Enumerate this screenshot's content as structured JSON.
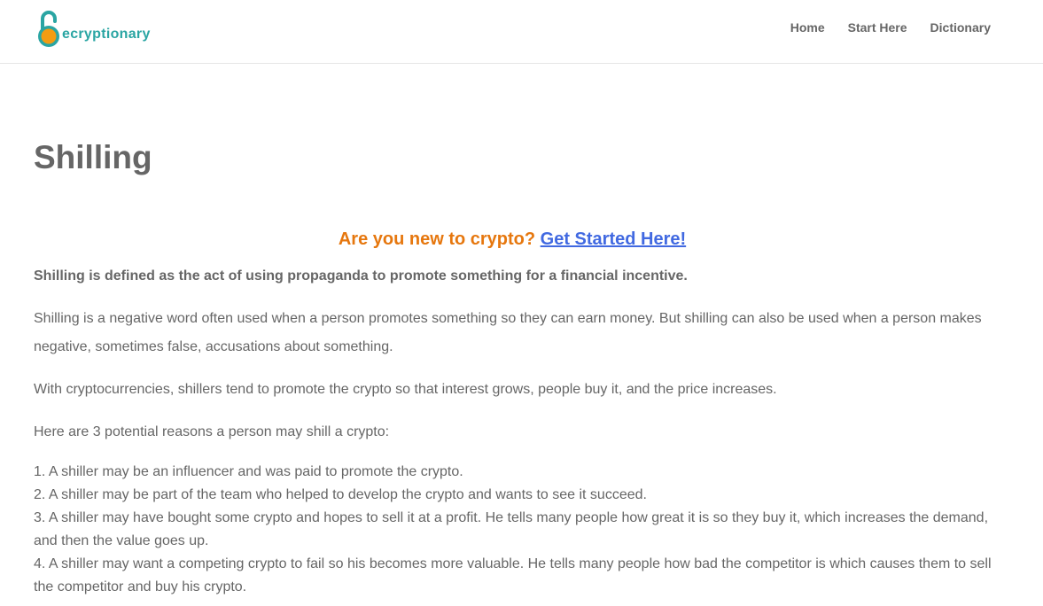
{
  "site": {
    "logo_text": "ecryptionary",
    "colors": {
      "brand_teal": "#2aa5a3",
      "brand_orange": "#f39c12",
      "cta_orange": "#e6770e",
      "link_blue": "#4169e1",
      "text_gray": "#666666"
    }
  },
  "nav": {
    "items": [
      {
        "label": "Home"
      },
      {
        "label": "Start Here"
      },
      {
        "label": "Dictionary"
      }
    ]
  },
  "article": {
    "title": "Shilling",
    "cta_prefix": "Are you new to crypto? ",
    "cta_link": "Get Started Here!",
    "lead": "Shilling is defined as the act of using propaganda to promote something for a financial incentive.",
    "paragraph_1": "Shilling is a negative word often used when a person promotes something so they can earn money. But shilling can also be used when a person makes negative, sometimes false, accusations about something.",
    "paragraph_2": "With cryptocurrencies, shillers tend to promote the crypto so that interest grows, people buy it, and the price increases.",
    "paragraph_3": "Here are 3 potential reasons a person may shill a crypto:",
    "reasons": [
      "1. A shiller may be an influencer and was paid to promote the crypto.",
      "2. A shiller may be part of the team who helped to develop the crypto and wants to see it succeed.",
      "3. A shiller may have bought some crypto and hopes to sell it at a profit. He tells many people how great it is so they buy it, which increases the demand, and then the value goes up.",
      "4. A shiller may want a competing crypto to fail so his becomes more valuable. He tells many people how bad the competitor is which causes them to sell the competitor and buy his crypto."
    ]
  }
}
